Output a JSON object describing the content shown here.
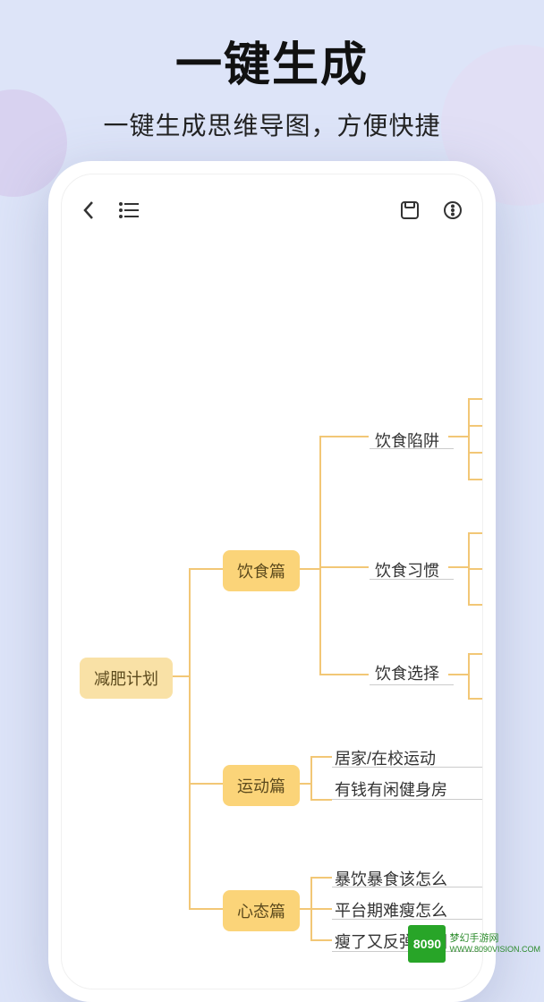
{
  "hero": {
    "title": "一键生成",
    "subtitle": "一键生成思维导图，方便快捷"
  },
  "mindmap": {
    "root": "减肥计划",
    "branches": [
      {
        "label": "饮食篇",
        "children": [
          "饮食陷阱",
          "饮食习惯",
          "饮食选择"
        ]
      },
      {
        "label": "运动篇",
        "children": [
          "居家/在校运动",
          "有钱有闲健身房"
        ]
      },
      {
        "label": "心态篇",
        "children": [
          "暴饮暴食该怎么",
          "平台期难瘦怎么",
          "瘦了又反弹胖回"
        ]
      }
    ]
  },
  "watermark": {
    "logo": "8090",
    "line1": "梦幻手游网",
    "line2": "WWW.8090VISION.COM"
  }
}
